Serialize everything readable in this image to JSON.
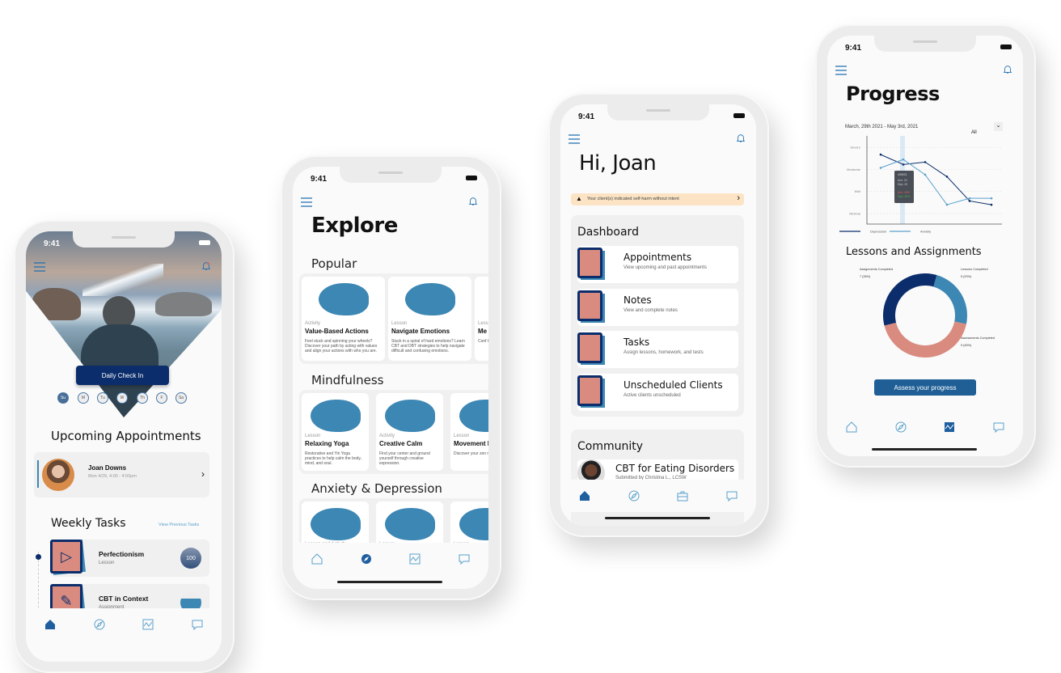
{
  "status": {
    "time": "9:41"
  },
  "colors": {
    "navy": "#0b2d6b",
    "accent": "#3d87b4",
    "salmon": "#d98b80",
    "alert_bg": "#fbe3c4"
  },
  "home": {
    "check_in": "Daily Check In",
    "days": [
      {
        "label": "Su",
        "done": true
      },
      {
        "label": "M"
      },
      {
        "label": "Tu"
      },
      {
        "label": "W"
      },
      {
        "label": "Th"
      },
      {
        "label": "F"
      },
      {
        "label": "Sa"
      }
    ],
    "appointments_title": "Upcoming Appointments",
    "appointment": {
      "name": "Joan Downs",
      "time": "Mon 4/29, 4:00 - 4:50pm"
    },
    "tasks_title": "Weekly Tasks",
    "view_previous": "View Previous Tasks",
    "tasks": [
      {
        "title": "Perfectionism",
        "type": "Lesson",
        "score": "100",
        "icon": "play-icon"
      },
      {
        "title": "CBT in Context",
        "type": "Assignment",
        "score": "",
        "icon": "pencil-icon"
      }
    ]
  },
  "explore": {
    "title": "Explore",
    "sections": [
      {
        "title": "Popular",
        "cards": [
          {
            "kind": "Activity",
            "title": "Value-Based Actions",
            "desc": "Feel stuck and spinning your wheels? Discover your path by acting with values and align your actions with who you are."
          },
          {
            "kind": "Lesson",
            "title": "Navigate Emotions",
            "desc": "Stuck in a spiral of hard emotions? Learn CBT and DBT strategies to help navigate difficult and confusing emotions."
          },
          {
            "kind": "Less",
            "title": "Me",
            "desc": "Conf track trick need"
          }
        ]
      },
      {
        "title": "Mindfulness",
        "cards": [
          {
            "kind": "Lesson",
            "title": "Relaxing Yoga",
            "desc": "Restorative and Yin Yoga practices to help calm the body, mind, and soul."
          },
          {
            "kind": "Activity",
            "title": "Creative Calm",
            "desc": "Find your center and ground yourself through creative expression."
          },
          {
            "kind": "Lesson",
            "title": "Movement Meditation",
            "desc": "Discover your zen movement."
          }
        ]
      },
      {
        "title": "Anxiety & Depression",
        "cards": [
          {
            "kind": "Lesson and Activity",
            "title": "",
            "desc": ""
          },
          {
            "kind": "Lesson",
            "title": "",
            "desc": ""
          },
          {
            "kind": "Lesson",
            "title": "",
            "desc": ""
          }
        ]
      }
    ]
  },
  "dashboard": {
    "greeting": "Hi, Joan",
    "alert": "Your client(s) indicated self-harm without intent",
    "title": "Dashboard",
    "items": [
      {
        "title": "Appointments",
        "sub": "View upcoming and past appointments",
        "icon": "calendar-icon"
      },
      {
        "title": "Notes",
        "sub": "View and complete notes",
        "icon": "notes-icon"
      },
      {
        "title": "Tasks",
        "sub": "Assign lessons, homework, and tests",
        "icon": "checklist-icon"
      },
      {
        "title": "Unscheduled Clients",
        "sub": "Active clients unscheduled",
        "icon": "calendar-asterisk-icon"
      }
    ],
    "community_title": "Community",
    "community_post": {
      "title": "CBT for Eating Disorders",
      "sub": "Submitted by Christina L., LCSW"
    }
  },
  "progress": {
    "title": "Progress",
    "date_range": "March, 29th 2021 - May 3rd, 2021",
    "filter": "All",
    "lessons_title": "Lessons and Assignments",
    "assess_button": "Assess your progress"
  },
  "chart_data": [
    {
      "type": "line",
      "y_levels": [
        "Minimal",
        "Mild",
        "Moderate",
        "Severe"
      ],
      "ylim": [
        1,
        4
      ],
      "grid": true,
      "legend": "bottom",
      "series": [
        {
          "name": "Depression",
          "color": "#0b2d6b",
          "values": [
            3.67,
            3.22,
            3.33,
            2.67,
            1.57,
            1.4
          ]
        },
        {
          "name": "Anxiety",
          "color": "#5aa0cc",
          "values": [
            3.07,
            3.45,
            2.76,
            1.4,
            1.69,
            1.69
          ]
        }
      ],
      "highlight_index": 1,
      "tooltip": {
        "date": "4/05/21",
        "lines": [
          "Anx: 22",
          "Dep: 20"
        ],
        "changes": [
          {
            "text": "Anx: 18%",
            "color": "#e0605a"
          },
          {
            "text": "Dep: 25%",
            "color": "#4caf50"
          }
        ]
      }
    },
    {
      "type": "pie",
      "donut": true,
      "slices": [
        {
          "label": "Lessons Completed",
          "value": 5,
          "text": "5 (20%)",
          "color": "#3d87b4"
        },
        {
          "label": "Assessments Completed",
          "value": 9,
          "text": "9 (45%)",
          "color": "#d98b80"
        },
        {
          "label": "Assignments Completed",
          "value": 7,
          "text": "7 (35%)",
          "color": "#0b2d6b"
        }
      ]
    }
  ]
}
